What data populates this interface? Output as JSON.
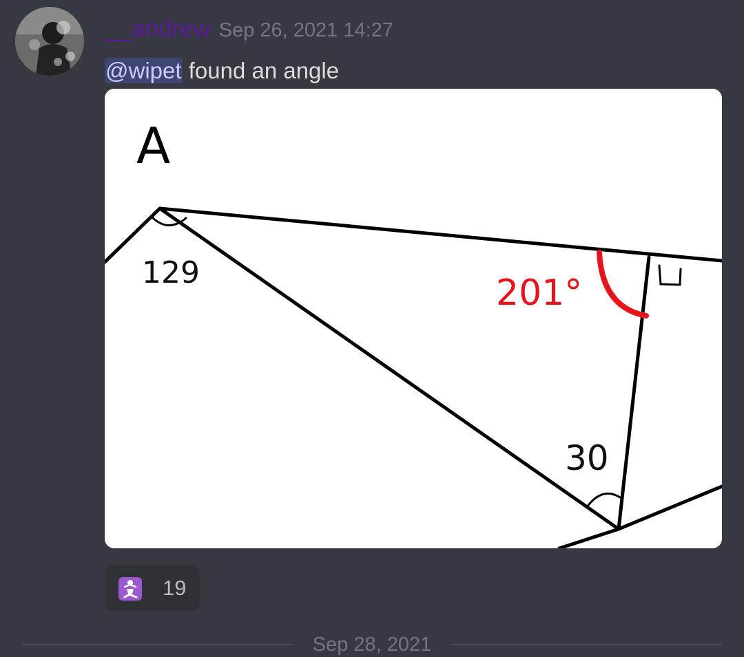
{
  "message": {
    "author": "__andrew",
    "timestamp": "Sep 26, 2021 14:27",
    "mention": "@wipet",
    "text": " found an angle",
    "attachment": {
      "labels": {
        "letter": "A",
        "angle1": "129",
        "angle2": "201°",
        "angle3": "30"
      },
      "highlight_color": "#e8141c"
    },
    "reactions": [
      {
        "emoji": "person-kneeling-emoji",
        "count": "19"
      }
    ]
  },
  "date_divider": "Sep 28, 2021",
  "colors": {
    "background": "#36393f",
    "username": "#5b1a9a",
    "timestamp": "#72767d",
    "mention_bg": "#5865f24d",
    "reaction_bg": "#2f3136"
  }
}
